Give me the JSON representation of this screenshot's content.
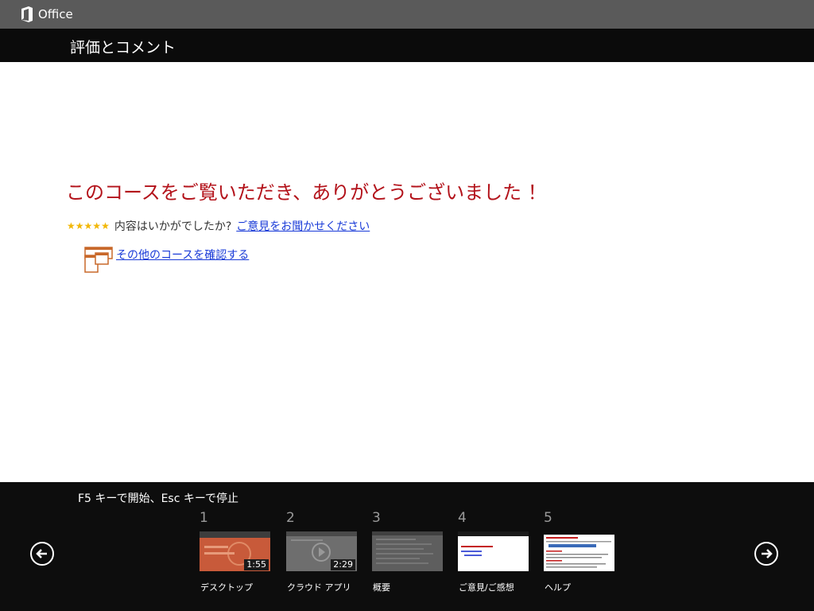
{
  "app": {
    "brand_label": "Office"
  },
  "header": {
    "title": "評価とコメント"
  },
  "main": {
    "thanks_message": "このコースをご覧いただき、ありがとうございました ！",
    "rating": {
      "stars": 5,
      "question": "内容はいかがでしたか?",
      "feedback_link": "ご意見をお聞かせください"
    },
    "more_courses_link": "その他のコースを確認する"
  },
  "bottom": {
    "hint": "F5 キーで開始、Esc キーで停止",
    "slides": [
      {
        "number": "1",
        "label": "デスクトップ",
        "duration": "1:55"
      },
      {
        "number": "2",
        "label": "クラウド アプリ",
        "duration": "2:29"
      },
      {
        "number": "3",
        "label": "概要",
        "duration": ""
      },
      {
        "number": "4",
        "label": "ご意見/ご感想",
        "duration": ""
      },
      {
        "number": "5",
        "label": "ヘルプ",
        "duration": ""
      }
    ]
  },
  "colors": {
    "accent_red": "#b3121a",
    "link_blue": "#1a3bd8",
    "star_gold": "#f2b705",
    "icon_orange": "#c8682a"
  },
  "icons": {
    "brand": "office-logo-icon",
    "prev": "arrow-left-circle-icon",
    "next": "arrow-right-circle-icon",
    "courses": "courses-windows-icon",
    "star": "star-icon"
  }
}
